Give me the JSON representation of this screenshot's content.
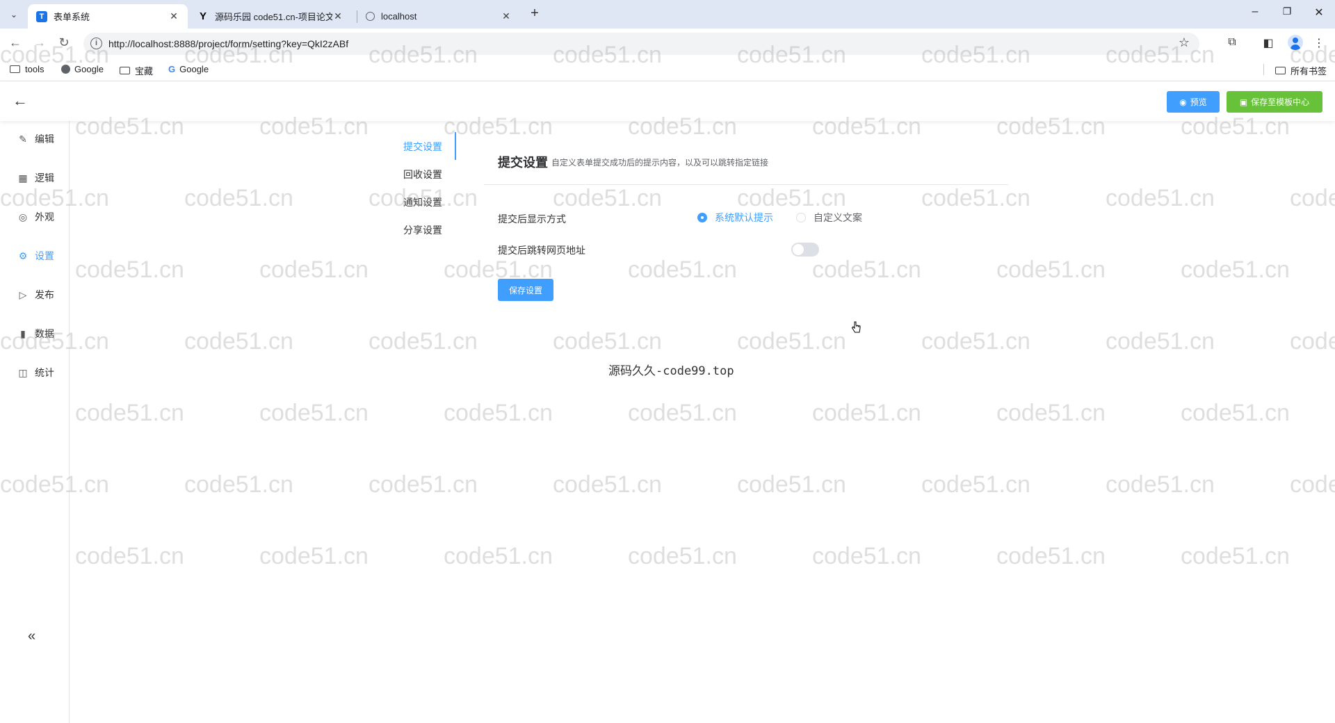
{
  "browser": {
    "tabs": [
      {
        "title": "表单系统",
        "favicon": "T",
        "active": true
      },
      {
        "title": "源码乐园 code51.cn-项目论文",
        "favicon": "Y",
        "active": false
      },
      {
        "title": "localhost",
        "favicon": "globe",
        "active": false
      }
    ],
    "url": "http://localhost:8888/project/form/setting?key=QkI2zABf",
    "bookmarks": [
      {
        "label": "tools",
        "icon": "folder-icon"
      },
      {
        "label": "Google",
        "icon": "globe-icon"
      },
      {
        "label": "宝藏",
        "icon": "folder-icon"
      },
      {
        "label": "Google",
        "icon": "google-icon"
      }
    ],
    "all_bookmarks": "所有书签"
  },
  "header": {
    "preview_label": "预览",
    "save_template_label": "保存至模板中心"
  },
  "sidebar": {
    "items": [
      {
        "label": "编辑",
        "icon": "edit-icon"
      },
      {
        "label": "逻辑",
        "icon": "grid-icon"
      },
      {
        "label": "外观",
        "icon": "eye-icon"
      },
      {
        "label": "设置",
        "icon": "gear-icon",
        "active": true
      },
      {
        "label": "发布",
        "icon": "play-icon"
      },
      {
        "label": "数据",
        "icon": "bar-chart-icon"
      },
      {
        "label": "统计",
        "icon": "stats-icon"
      }
    ]
  },
  "subnav": {
    "items": [
      {
        "label": "提交设置",
        "active": true
      },
      {
        "label": "回收设置"
      },
      {
        "label": "通知设置"
      },
      {
        "label": "分享设置"
      }
    ]
  },
  "panel": {
    "title": "提交设置",
    "description": "自定义表单提交成功后的提示内容，以及可以跳转指定链接",
    "display_label": "提交后显示方式",
    "option_default": "系统默认提示",
    "option_custom": "自定义文案",
    "redirect_label": "提交后跳转网页地址",
    "redirect_enabled": false,
    "save_button": "保存设置"
  },
  "footer_text": "源码久久-code99.top",
  "watermark_text": "code51.cn"
}
